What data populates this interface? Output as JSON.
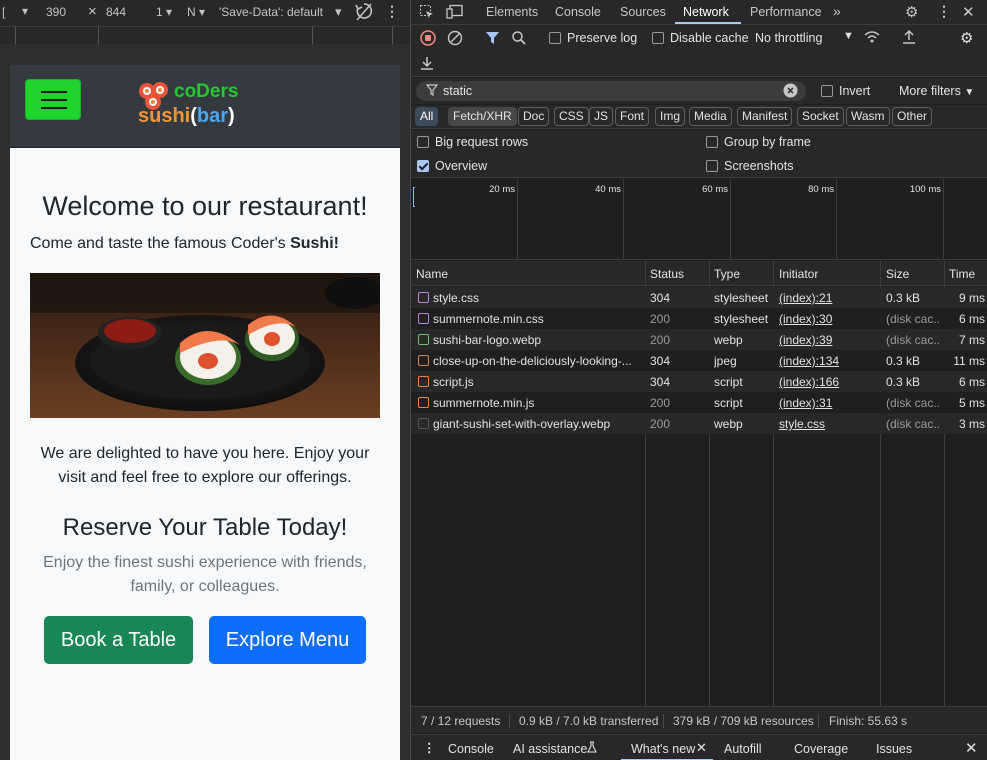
{
  "device_toolbar": {
    "dims_width": "390",
    "dims_sep": "×",
    "dims_height": "844",
    "zoom": "1",
    "network": "N",
    "save_data": "'Save-Data': default"
  },
  "page": {
    "logo_top": "coDers",
    "logo_bottom_a": "sushi",
    "logo_bottom_b": "(",
    "logo_bottom_c": "bar",
    "logo_bottom_d": ")",
    "welcome": "Welcome to our restaurant!",
    "come_prefix": "Come and taste the famous Coder's ",
    "come_bold": "Sushi!",
    "delight": "We are delighted to have you here. Enjoy your visit and feel free to explore our offerings.",
    "reserve": "Reserve Your Table Today!",
    "enjoy": "Enjoy the finest sushi experience with friends, family, or colleagues.",
    "book": "Book a Table",
    "explore": "Explore Menu"
  },
  "devtools": {
    "tabs": [
      "Elements",
      "Console",
      "Sources",
      "Network",
      "Performance"
    ],
    "active_tab": "Network",
    "toolbar": {
      "preserve_log": "Preserve log",
      "disable_cache": "Disable cache",
      "throttling": "No throttling"
    },
    "filter": {
      "value": "static",
      "invert": "Invert",
      "more_filters": "More filters"
    },
    "chips": [
      "All",
      "Fetch/XHR",
      "Doc",
      "CSS",
      "JS",
      "Font",
      "Img",
      "Media",
      "Manifest",
      "Socket",
      "Wasm",
      "Other"
    ],
    "options": {
      "big_rows": "Big request rows",
      "group_frame": "Group by frame",
      "overview": "Overview",
      "screenshots": "Screenshots"
    },
    "timeline_labels": [
      "20 ms",
      "40 ms",
      "60 ms",
      "80 ms",
      "100 ms"
    ],
    "columns": [
      "Name",
      "Status",
      "Type",
      "Initiator",
      "Size",
      "Time"
    ],
    "requests": [
      {
        "name": "style.css",
        "status": "304",
        "type": "stylesheet",
        "initiator": "(index):21",
        "size": "0.3 kB",
        "time": "9 ms",
        "icon": "css-file-icon",
        "color": "#b884e0"
      },
      {
        "name": "summernote.min.css",
        "status": "200",
        "type": "stylesheet",
        "initiator": "(index):30",
        "size": "(disk cac...",
        "time": "6 ms",
        "icon": "css-file-icon",
        "color": "#b884e0"
      },
      {
        "name": "sushi-bar-logo.webp",
        "status": "200",
        "type": "webp",
        "initiator": "(index):39",
        "size": "(disk cac...",
        "time": "7 ms",
        "icon": "image-file-icon",
        "color": "#6fbf73"
      },
      {
        "name": "close-up-on-the-deliciously-looking-...",
        "status": "304",
        "type": "jpeg",
        "initiator": "(index):134",
        "size": "0.3 kB",
        "time": "11 ms",
        "icon": "image-file-icon",
        "color": "#d9834a"
      },
      {
        "name": "script.js",
        "status": "304",
        "type": "script",
        "initiator": "(index):166",
        "size": "0.3 kB",
        "time": "6 ms",
        "icon": "js-file-icon",
        "color": "#e8853e"
      },
      {
        "name": "summernote.min.js",
        "status": "200",
        "type": "script",
        "initiator": "(index):31",
        "size": "(disk cac...",
        "time": "5 ms",
        "icon": "js-file-icon",
        "color": "#e8853e"
      },
      {
        "name": "giant-sushi-set-with-overlay.webp",
        "status": "200",
        "type": "webp",
        "initiator": "style.css",
        "size": "(disk cac...",
        "time": "3 ms",
        "icon": "image-file-icon",
        "color": "#555555"
      }
    ],
    "status_bar": {
      "requests": "7 / 12 requests",
      "transferred": "0.9 kB / 7.0 kB transferred",
      "resources": "379 kB / 709 kB resources",
      "finish": "Finish: 55.63 s"
    },
    "drawer_tabs": [
      "Console",
      "AI assistance",
      "What's new",
      "Autofill",
      "Coverage",
      "Issues"
    ],
    "active_drawer_tab": "What's new"
  },
  "colors": {
    "hamburger": "#1fd42a",
    "book_button": "#198754",
    "explore_button": "#0d6efd",
    "accent": "#a8c7fa"
  }
}
